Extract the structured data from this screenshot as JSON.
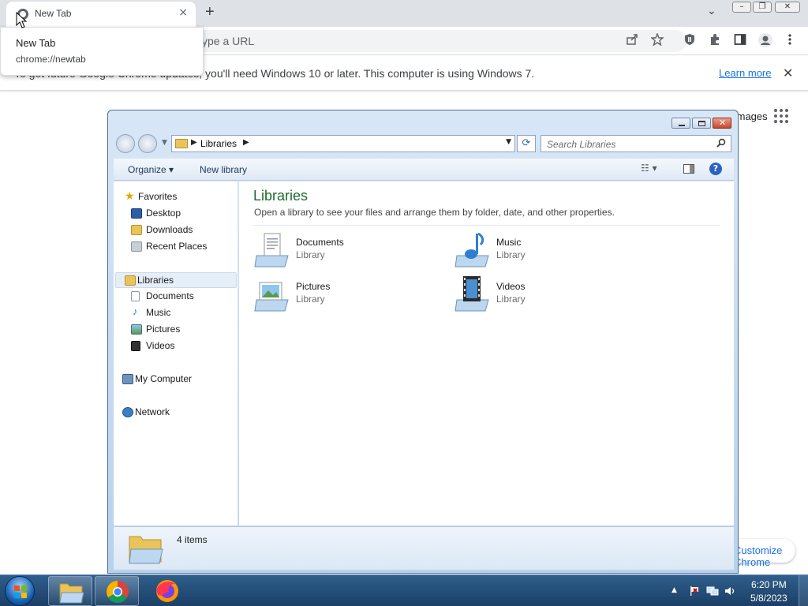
{
  "chrome": {
    "tab": {
      "title": "New Tab",
      "close_glyph": "×"
    },
    "new_tab_glyph": "+",
    "tab_search_glyph": "⌄",
    "window_controls": {
      "minimize": "–",
      "restore": "❐",
      "close": "✕"
    },
    "omnibox": {
      "text": "ype a URL"
    },
    "toolbar_icons": {
      "share": "share-icon",
      "bookmark": "star-icon",
      "extension_shield": "shield-icon",
      "extensions": "puzzle-icon",
      "side_panel": "side-panel-icon",
      "profile": "profile-icon",
      "menu": "kebab-menu-icon"
    },
    "tooltip": {
      "title": "New Tab",
      "url": "chrome://newtab"
    },
    "infobar": {
      "message": "To get future Google Chrome updates, you'll need Windows 10 or later. This computer is using Windows 7.",
      "link": "Learn more",
      "close_glyph": "✕"
    },
    "ntp": {
      "images_link": "Images",
      "customize": "Customize Chrome"
    }
  },
  "explorer": {
    "address": {
      "location": "Libraries"
    },
    "search_placeholder": "Search Libraries",
    "commands": {
      "organize": "Organize ▾",
      "new_library": "New library"
    },
    "nav": {
      "favorites": {
        "label": "Favorites",
        "items": [
          "Desktop",
          "Downloads",
          "Recent Places"
        ]
      },
      "libraries": {
        "label": "Libraries",
        "items": [
          "Documents",
          "Music",
          "Pictures",
          "Videos"
        ]
      },
      "computer": "My Computer",
      "network": "Network"
    },
    "content": {
      "heading": "Libraries",
      "description": "Open a library to see your files and arrange them by folder, date, and other properties.",
      "libraries": [
        {
          "name": "Documents",
          "type": "Library"
        },
        {
          "name": "Music",
          "type": "Library"
        },
        {
          "name": "Pictures",
          "type": "Library"
        },
        {
          "name": "Videos",
          "type": "Library"
        }
      ]
    },
    "details": {
      "count": "4 items"
    }
  },
  "taskbar": {
    "apps": [
      "windows-explorer",
      "google-chrome",
      "firefox"
    ],
    "clock": {
      "time": "6:20 PM",
      "date": "5/8/2023"
    }
  },
  "colors": {
    "chrome_tabbar": "#dee1e6",
    "link_blue": "#1a73e8",
    "explorer_heading": "#1e6a2e",
    "taskbar": "#1b3f66"
  }
}
